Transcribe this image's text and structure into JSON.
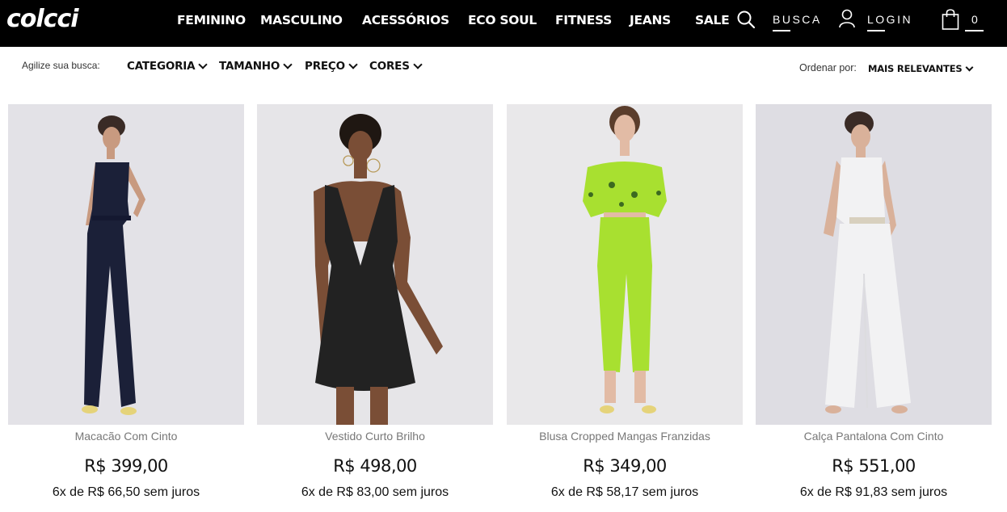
{
  "brand": "colcci",
  "nav": {
    "items": [
      {
        "label": "FEMININO"
      },
      {
        "label": "MASCULINO"
      },
      {
        "label": "ACESSÓRIOS"
      },
      {
        "label": "ECO SOUL"
      },
      {
        "label": "FITNESS"
      },
      {
        "label": "JEANS"
      },
      {
        "label": "SALE"
      }
    ],
    "search_label": "BUSCA",
    "login_label": "LOGIN",
    "cart_count": "0",
    "icons": [
      "search-icon",
      "user-icon",
      "shopping-bag-icon"
    ]
  },
  "filters": {
    "hint": "Agilize sua busca:",
    "items": [
      {
        "label": "CATEGORIA"
      },
      {
        "label": "TAMANHO"
      },
      {
        "label": "PREÇO"
      },
      {
        "label": "CORES"
      }
    ],
    "sort_label": "Ordenar por:",
    "sort_value": "MAIS RELEVANTES"
  },
  "products": [
    {
      "name": "Macacão Com Cinto",
      "price": "R$ 399,00",
      "installment": "6x de R$ 66,50 sem juros",
      "garment_color": "#1b2038",
      "image_bg": "#e3e2e7"
    },
    {
      "name": "Vestido Curto Brilho",
      "price": "R$ 498,00",
      "installment": "6x de R$ 83,00 sem juros",
      "garment_color": "#222222",
      "image_bg": "#e6e5e8"
    },
    {
      "name": "Blusa Cropped Mangas Franzidas",
      "price": "R$ 349,00",
      "installment": "6x de R$ 58,17 sem juros",
      "garment_color": "#a8e030",
      "image_bg": "#e9e8ea"
    },
    {
      "name": "Calça Pantalona Com Cinto",
      "price": "R$ 551,00",
      "installment": "6x de R$ 91,83 sem juros",
      "garment_color": "#f2f2f3",
      "image_bg": "#dedde3"
    }
  ],
  "colors": {
    "header_bg": "#000000",
    "header_text": "#ffffff",
    "product_name": "#777777"
  }
}
